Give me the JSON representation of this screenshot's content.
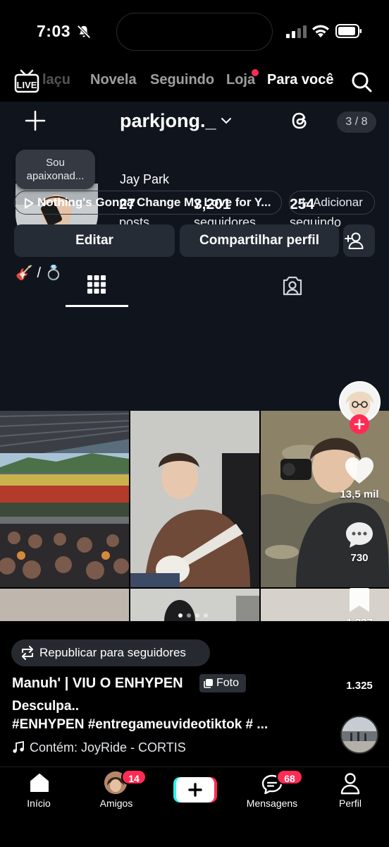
{
  "status_bar": {
    "time": "7:03"
  },
  "top_nav": {
    "tabs": [
      {
        "label": "laçu",
        "state": "faded"
      },
      {
        "label": "Novela",
        "state": "inactive"
      },
      {
        "label": "Seguindo",
        "state": "inactive"
      },
      {
        "label": "Loja",
        "state": "inactive",
        "has_dot": true
      },
      {
        "label": "Para você",
        "state": "active"
      }
    ]
  },
  "profile": {
    "username": "parkjong._",
    "page_indicator": "3 / 8",
    "note_line1": "Sou",
    "note_line2": "apaixonad...",
    "display_name": "Jay Park",
    "stats": [
      {
        "value": "27",
        "label": "posts"
      },
      {
        "value": "3,201",
        "label": "seguidores"
      },
      {
        "value": "254",
        "label": "seguindo"
      }
    ],
    "bio": "🎸 / 💍",
    "music": "Nothing's Gonna Change My Love for Y...",
    "add_label": "Adicionar",
    "edit_label": "Editar",
    "share_label": "Compartilhar perfil"
  },
  "actions": {
    "likes": "13,5 mil",
    "comments": "730",
    "saves": "1.337",
    "shares": "1.325"
  },
  "post": {
    "repost_label": "Republicar para seguidores",
    "author": "Manuh' | VIU O ENHYPEN",
    "type_tag": "Foto",
    "caption": "Desculpa..",
    "hashtags": "#ENHYPEN #entregameuvideotiktok # ...",
    "sound": "Contém: JoyRide - CORTIS"
  },
  "bottom_nav": {
    "home": "Início",
    "friends": "Amigos",
    "friends_badge": "14",
    "messages": "Mensagens",
    "messages_badge": "68",
    "profile": "Perfil"
  },
  "colors": {
    "accent_red": "#fe2c55",
    "profile_bg": "#10151d",
    "button_bg": "#262c35"
  }
}
